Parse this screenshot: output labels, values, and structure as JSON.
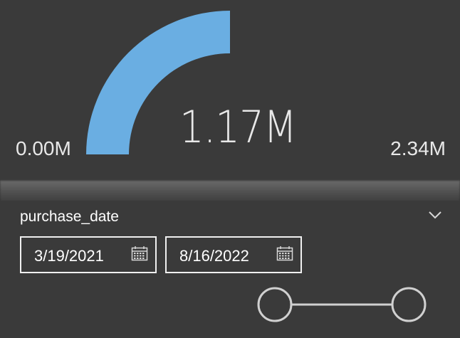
{
  "gauge": {
    "min_label": "0.00M",
    "max_label": "2.34M",
    "value_label": "1.17M",
    "fill_fraction": 0.5,
    "fill_color": "#6aaee2"
  },
  "slicer": {
    "field_label": "purchase_date",
    "start_date": "3/19/2021",
    "end_date": "8/16/2022",
    "start_icon": "calendar-icon",
    "end_icon": "calendar-icon",
    "expand_icon": "chevron-down-icon",
    "range_start_fraction": 0.0,
    "range_end_fraction": 1.0
  }
}
